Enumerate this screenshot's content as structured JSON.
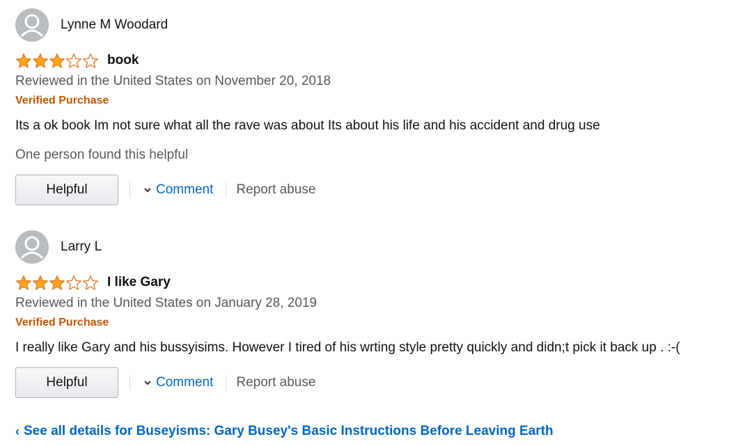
{
  "reviews": [
    {
      "reviewer": "Lynne M Woodard",
      "rating": 3,
      "max_rating": 5,
      "title": "book",
      "date": "Reviewed in the United States on November 20, 2018",
      "verified": "Verified Purchase",
      "body": "Its a ok book Im not sure what all the rave was about Its about his life and his accident and drug use",
      "helpful_count": "One person found this helpful",
      "helpful_label": "Helpful",
      "comment_label": "Comment",
      "report_label": "Report abuse"
    },
    {
      "reviewer": "Larry L",
      "rating": 3,
      "max_rating": 5,
      "title": "I like Gary",
      "date": "Reviewed in the United States on January 28, 2019",
      "verified": "Verified Purchase",
      "body": "I really like Gary and his bussyisims. However I tired of his wrting style pretty quickly and didn;t pick it back up . :-(",
      "helpful_label": "Helpful",
      "comment_label": "Comment",
      "report_label": "Report abuse"
    }
  ],
  "see_all": {
    "chevron": "‹",
    "label": "See all details for Buseyisms: Gary Busey's Basic Instructions Before Leaving Earth"
  },
  "colors": {
    "star_fill": "#ffa41c",
    "star_stroke": "#de7921",
    "link": "#0066c0",
    "verified": "#c45500",
    "muted": "#565959"
  },
  "icons": {
    "avatar": "default-user-avatar-icon",
    "star": "star-icon",
    "chevron": "chevron-down-icon"
  }
}
